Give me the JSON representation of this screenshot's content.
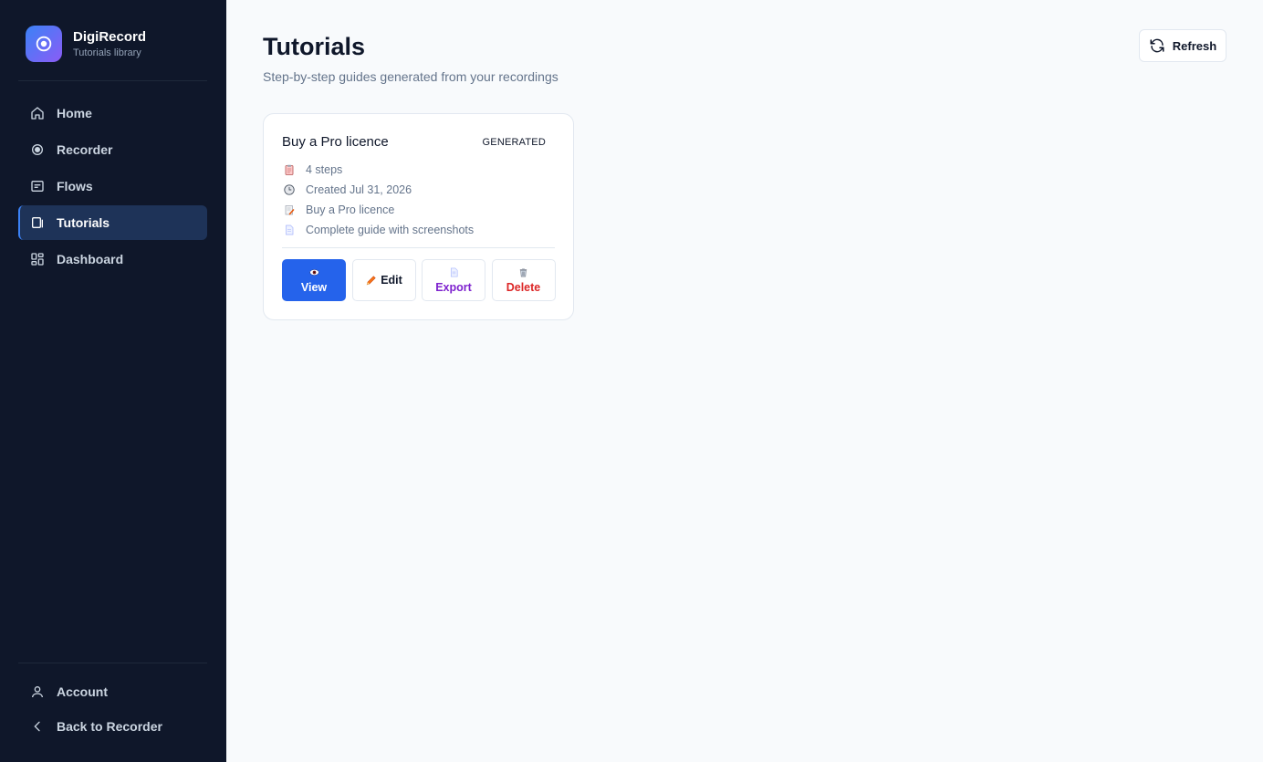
{
  "brand": {
    "name": "DigiRecord",
    "subtitle": "Tutorials library"
  },
  "sidebar": {
    "items": [
      {
        "label": "Home",
        "icon": "home-icon",
        "active": false
      },
      {
        "label": "Recorder",
        "icon": "record-icon",
        "active": false
      },
      {
        "label": "Flows",
        "icon": "flows-icon",
        "active": false
      },
      {
        "label": "Tutorials",
        "icon": "tutorials-icon",
        "active": true
      },
      {
        "label": "Dashboard",
        "icon": "dashboard-icon",
        "active": false
      }
    ],
    "bottom": [
      {
        "label": "Account",
        "icon": "user-icon"
      },
      {
        "label": "Back to Recorder",
        "icon": "chevron-left-icon"
      }
    ]
  },
  "header": {
    "title": "Tutorials",
    "subtitle": "Step-by-step guides generated from your recordings",
    "refresh_label": "Refresh"
  },
  "tutorials": [
    {
      "title": "Buy a Pro licence",
      "status": "GENERATED",
      "steps": "4 steps",
      "created": "Created Jul 31, 2026",
      "source": "Buy a Pro licence",
      "description": "Complete guide with screenshots",
      "actions": {
        "view": "View",
        "edit": "Edit",
        "export": "Export",
        "delete": "Delete"
      }
    }
  ],
  "colors": {
    "sidebar_bg": "#0f172a",
    "accent": "#2563eb",
    "export": "#7e22ce",
    "delete": "#dc2626"
  }
}
